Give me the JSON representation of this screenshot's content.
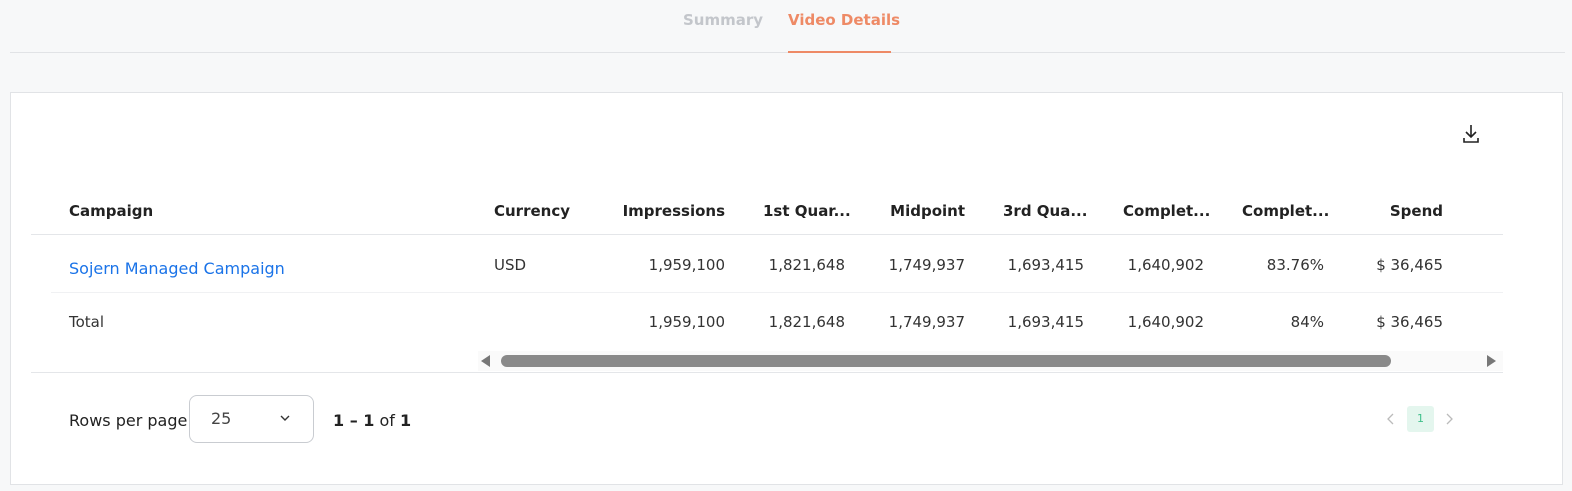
{
  "tabs": [
    {
      "label": "Summary",
      "active": false
    },
    {
      "label": "Video Details",
      "active": true
    }
  ],
  "colors": {
    "accent": "#ee8a66",
    "link": "#1a73e8",
    "page_active_bg": "#e4f6ee",
    "page_active_fg": "#3fbf8a"
  },
  "toolbar": {
    "download_icon": "download-icon"
  },
  "table": {
    "columns": [
      "Campaign",
      "Currency",
      "Impressions",
      "1st Quar...",
      "Midpoint",
      "3rd Qua...",
      "Complet...",
      "Complet...",
      "Spend"
    ],
    "rows": [
      [
        "Sojern Managed Campaign",
        "USD",
        "1,959,100",
        "1,821,648",
        "1,749,937",
        "1,693,415",
        "1,640,902",
        "83.76%",
        "$ 36,465"
      ]
    ],
    "total": [
      "Total",
      "",
      "1,959,100",
      "1,821,648",
      "1,749,937",
      "1,693,415",
      "1,640,902",
      "84%",
      "$ 36,465"
    ]
  },
  "pagination": {
    "rows_per_page_label": "Rows per page",
    "rows_per_page_value": "25",
    "range_start": "1",
    "range_sep": " – ",
    "range_end": "1",
    "of_label": " of ",
    "total": "1",
    "current_page": "1"
  }
}
